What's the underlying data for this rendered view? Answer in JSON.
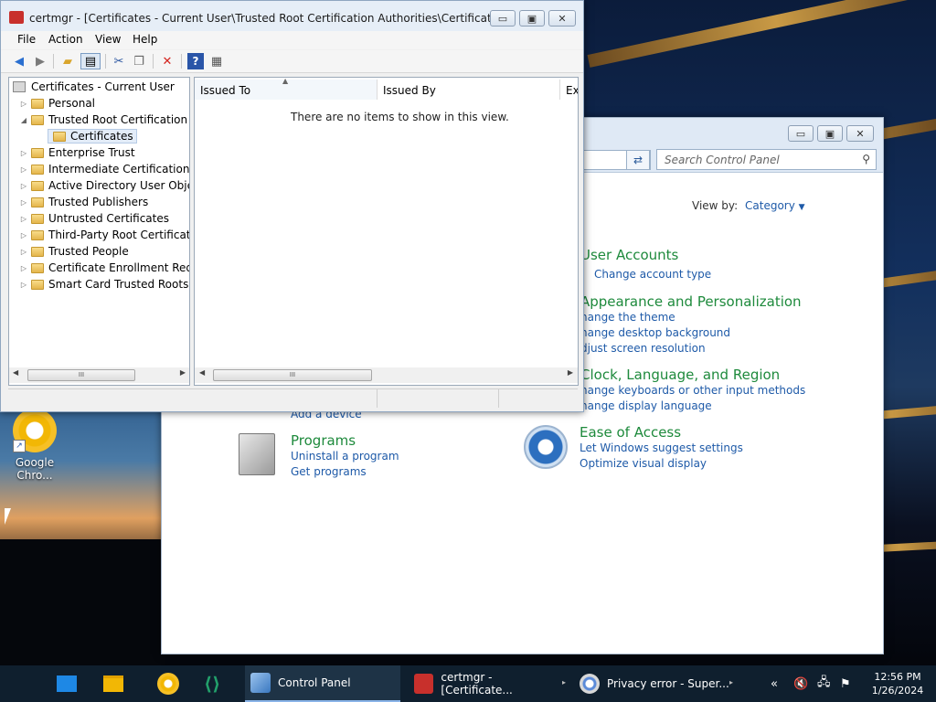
{
  "certmgr": {
    "title": "certmgr - [Certificates - Current User\\Trusted Root Certification Authorities\\Certificates]",
    "window_controls": {
      "minimize": "▭",
      "maximize": "▣",
      "close": "✕"
    },
    "menu": [
      "File",
      "Action",
      "View",
      "Help"
    ],
    "toolbar_icons": [
      "back-arrow-icon",
      "forward-arrow-icon",
      "up-folder-icon",
      "show-hide-tree-icon",
      "cut-icon",
      "copy-icon",
      "delete-icon",
      "help-icon",
      "properties-icon"
    ],
    "tree": {
      "root": "Certificates - Current User",
      "items": [
        {
          "label": "Personal",
          "expander": "▷"
        },
        {
          "label": "Trusted Root Certification Au",
          "expander": "◢"
        },
        {
          "label": "Certificates",
          "expander": ""
        },
        {
          "label": "Enterprise Trust",
          "expander": "▷"
        },
        {
          "label": "Intermediate Certification Au",
          "expander": "▷"
        },
        {
          "label": "Active Directory User Object",
          "expander": "▷"
        },
        {
          "label": "Trusted Publishers",
          "expander": "▷"
        },
        {
          "label": "Untrusted Certificates",
          "expander": "▷"
        },
        {
          "label": "Third-Party Root Certificatior",
          "expander": "▷"
        },
        {
          "label": "Trusted People",
          "expander": "▷"
        },
        {
          "label": "Certificate Enrollment Reque:",
          "expander": "▷"
        },
        {
          "label": "Smart Card Trusted Roots",
          "expander": "▷"
        }
      ]
    },
    "list": {
      "columns": [
        "Issued To",
        "Issued By",
        "Ex"
      ],
      "empty_message": "There are no items to show in this view."
    },
    "scroll_thumb": "III"
  },
  "control_panel": {
    "window_controls": {
      "minimize": "▭",
      "maximize": "▣",
      "close": "✕"
    },
    "search_placeholder": "Search Control Panel",
    "view_by_label": "View by:",
    "view_by_value": "Category",
    "sections": [
      {
        "heading": "User Accounts",
        "links": [
          "Change account type"
        ]
      },
      {
        "heading": "Appearance and Personalization",
        "links": [
          "hange the theme",
          "hange desktop background",
          "djust screen resolution"
        ]
      },
      {
        "heading": "Clock, Language, and Region",
        "links": [
          "hange keyboards or other input methods",
          "hange display language"
        ]
      },
      {
        "heading": "Ease of Access",
        "links": [
          "Let Windows suggest settings",
          "Optimize visual display"
        ]
      },
      {
        "heading": "Programs",
        "links": [
          "Uninstall a program",
          "Get programs"
        ]
      }
    ],
    "partial_link": "Add a device"
  },
  "desktop": {
    "icons": [
      {
        "label": "Google Chro...",
        "icon": "chrome-icon"
      }
    ]
  },
  "taskbar": {
    "pinned": [
      "start-icon",
      "desktop-icon",
      "file-explorer-icon",
      "chrome-icon",
      "vscode-icon"
    ],
    "tasks": [
      {
        "label": "Control Panel",
        "icon": "control-panel-icon"
      },
      {
        "label": "certmgr - [Certificate...",
        "icon": "certmgr-icon"
      },
      {
        "label": "Privacy error - Super...",
        "icon": "chrome-icon"
      }
    ],
    "tray_icons": [
      "chevron-icon",
      "speaker-muted-icon",
      "network-icon",
      "action-center-icon"
    ],
    "time": "12:56 PM",
    "date": "1/26/2024"
  }
}
